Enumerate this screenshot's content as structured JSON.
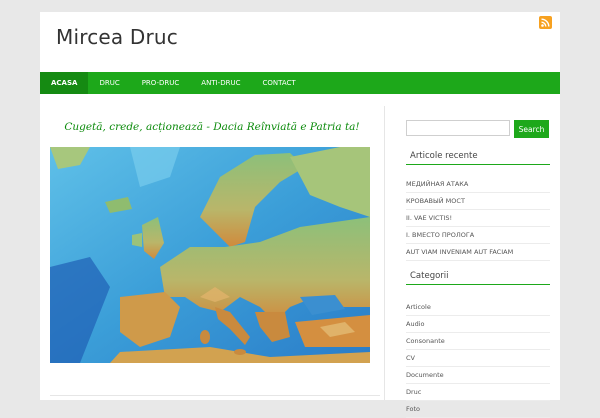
{
  "site": {
    "title": "Mircea Druc"
  },
  "nav": {
    "items": [
      {
        "label": "ACASA",
        "active": true
      },
      {
        "label": "DRUC",
        "active": false
      },
      {
        "label": "PRO-DRUC",
        "active": false
      },
      {
        "label": "ANTI-DRUC",
        "active": false
      },
      {
        "label": "CONTACT",
        "active": false
      }
    ]
  },
  "main": {
    "tagline": "Cugetă, crede, acționează - Dacia Reînviată e Patria ta!"
  },
  "search": {
    "placeholder": "",
    "value": "",
    "button_label": "Search"
  },
  "recent": {
    "title": "Articole recente",
    "items": [
      "МЕДИЙНАЯ АТАКА",
      "КРОВАВЫЙ МОСТ",
      "II. VAE VICTIS!",
      "I. ВМЕСТО ПРОЛОГА",
      "AUT VIAM INVENIAM AUT FACIAM"
    ]
  },
  "categories": {
    "title": "Categorii",
    "items": [
      "Articole",
      "Audio",
      "Consonante",
      "CV",
      "Documente",
      "Druc",
      "Foto"
    ]
  },
  "colors": {
    "accent": "#1da81a",
    "tagline": "#0a8a0a",
    "rss": "#f7a120"
  },
  "icons": {
    "rss": "rss-icon"
  }
}
